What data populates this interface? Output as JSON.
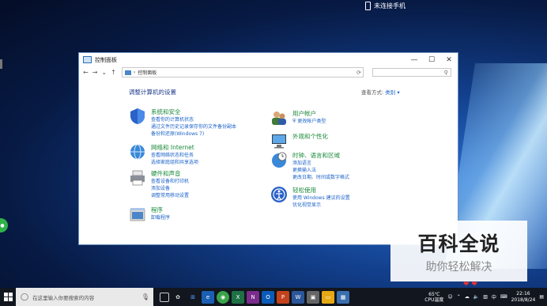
{
  "desktop": {
    "phone_status": "未连接手机"
  },
  "window": {
    "title": "控制面板",
    "controls": {
      "min": "—",
      "max": "☐",
      "close": "✕"
    },
    "nav": {
      "back": "←",
      "forward": "→",
      "up": "↑"
    },
    "address": "控制面板",
    "search_placeholder": ""
  },
  "content": {
    "heading": "调整计算机的设置",
    "view_by_label": "查看方式:",
    "view_by_value": "类别 ▾"
  },
  "categories_left": [
    {
      "title": "系统和安全",
      "icon": "shield-icon",
      "links": [
        "查看你的计算机状态",
        "通过文件历史记录保存你的文件备份副本",
        "备份和还原(Windows 7)"
      ]
    },
    {
      "title": "网络和 Internet",
      "icon": "network-icon",
      "links": [
        "查看网络状态和任务",
        "选择家庭组和共享选项"
      ]
    },
    {
      "title": "硬件和声音",
      "icon": "printer-icon",
      "links": [
        "查看设备和打印机",
        "添加设备",
        "调整常用移动设置"
      ]
    },
    {
      "title": "程序",
      "icon": "programs-icon",
      "links": [
        "卸载程序"
      ]
    }
  ],
  "categories_right": [
    {
      "title": "用户帐户",
      "icon": "users-icon",
      "links": [
        "更改帐户类型"
      ]
    },
    {
      "title": "外观和个性化",
      "icon": "monitor-icon",
      "links": []
    },
    {
      "title": "时钟、语言和区域",
      "icon": "globe-clock-icon",
      "links": [
        "添加语言",
        "更换输入法",
        "更改日期、时间或数字格式"
      ]
    },
    {
      "title": "轻松使用",
      "icon": "accessibility-icon",
      "links": [
        "使用 Windows 建议的设置",
        "优化视觉显示"
      ]
    }
  ],
  "taskbar": {
    "search_placeholder": "在这里输入你要搜索的内容",
    "temp": "65℃",
    "temp_label": "CPU温度",
    "ime": "中",
    "time": "22:16",
    "date": "2018/8/24"
  },
  "watermark": {
    "main": "百科全说",
    "sub": "助你轻松解决"
  }
}
